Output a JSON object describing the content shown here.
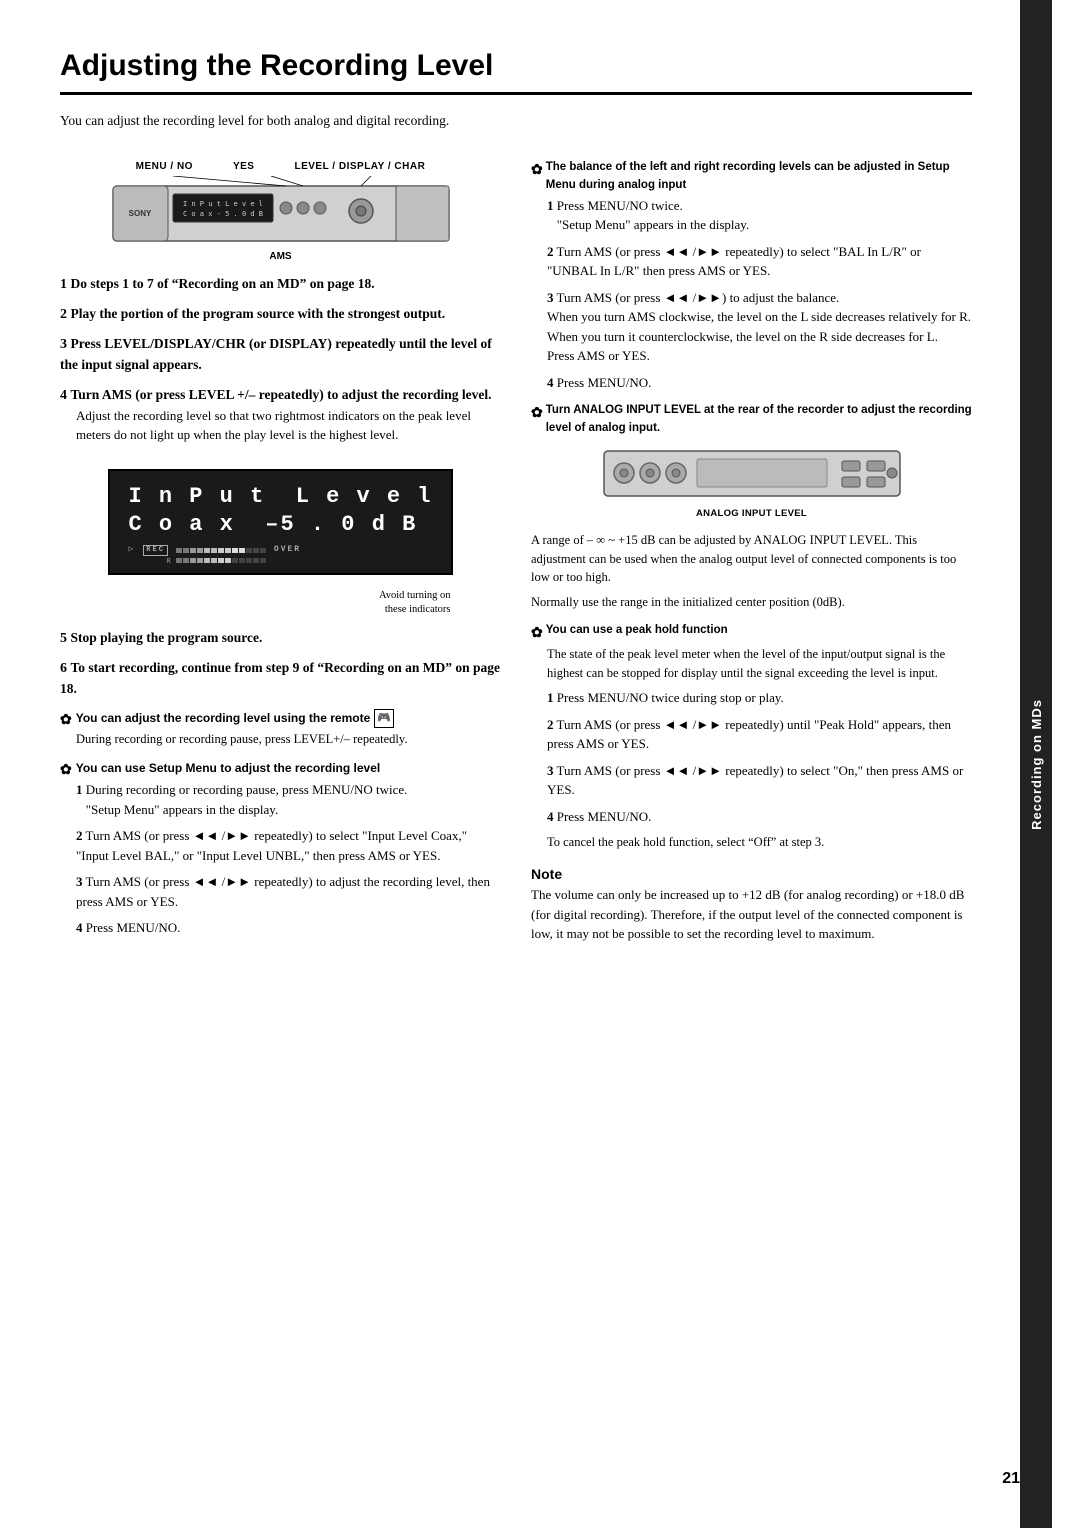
{
  "page": {
    "title": "Adjusting the Recording Level",
    "sidebar_label": "Recording on MDs",
    "page_number": "21",
    "intro": "You can adjust the recording level for both analog and digital recording."
  },
  "diagram_top": {
    "labels": [
      "MENU / NO",
      "YES",
      "LEVEL / DISPLAY / CHAR"
    ],
    "ams_label": "AMS",
    "avoid_text": "Avoid turning on\nthese indicators"
  },
  "analog_diagram": {
    "label": "ANALOG INPUT LEVEL"
  },
  "left_col": {
    "steps": [
      {
        "num": "1",
        "bold": "Do steps 1 to 7 of “Recording on an MD” on page 18."
      },
      {
        "num": "2",
        "bold": "Play the portion of the program source with the strongest output."
      },
      {
        "num": "3",
        "bold": "Press LEVEL/DISPLAY/CHR (or DISPLAY) repeatedly until the level of the input signal appears."
      },
      {
        "num": "4",
        "bold": "Turn AMS (or press LEVEL +/– repeatedly) to adjust the recording level.",
        "body": "Adjust the recording level so that two rightmost indicators on the peak level meters do not light up when the play level is the highest level."
      },
      {
        "num": "5",
        "bold": "Stop playing the program source."
      },
      {
        "num": "6",
        "bold": "To start recording, continue from step 9 of “Recording on an MD” on page 18."
      }
    ],
    "tip1": {
      "header": "You can adjust the recording level using the remote",
      "body": "During recording or recording pause, press LEVEL+/– repeatedly."
    },
    "tip2": {
      "header": "You can use Setup Menu to adjust the recording level",
      "steps": [
        {
          "num": "1",
          "text": "During recording or recording pause, press MENU/NO twice.\n“Setup Menu” appears in the display."
        },
        {
          "num": "2",
          "text": "Turn AMS (or press ◄◄ /►►► repeatedly) to select “Input Level Coax,” “Input Level BAL,” or “Input Level UNBL,” then press AMS or YES."
        },
        {
          "num": "3",
          "text": "Turn AMS (or press ◄◄ /►►► repeatedly) to adjust the recording level, then press AMS or YES."
        },
        {
          "num": "4",
          "text": "Press MENU/NO."
        }
      ]
    }
  },
  "right_col": {
    "tip_balance": {
      "header": "The balance of the left and right recording levels can be adjusted in Setup Menu during analog input",
      "steps": [
        {
          "num": "1",
          "text": "Press MENU/NO twice.\n“Setup Menu” appears in the display."
        },
        {
          "num": "2",
          "text": "Turn AMS (or press ◄◄ /►►► repeatedly) to select “BAL In L/R” or “UNBAL In L/R” then press AMS or YES."
        },
        {
          "num": "3",
          "text": "Turn AMS (or press ◄◄ /►►►) to adjust the balance.\nWhen you turn AMS clockwise, the level on the L side decreases relatively for R. When you turn it counterclockwise, the level on the R side decreases for L.\nPress AMS or YES."
        },
        {
          "num": "4",
          "text": "Press MENU/NO."
        }
      ]
    },
    "tip_analog": {
      "header": "Turn ANALOG INPUT LEVEL at the rear of the recorder to adjust the recording level of analog input."
    },
    "analog_range_text": "A range of – ∞ ~ +15 dB can be adjusted by ANALOG INPUT LEVEL. This adjustment can be used when the analog output level of connected components is too low or too high.",
    "analog_normal_text": "Normally use the range in the initialized center position (0dB).",
    "tip_peak": {
      "header": "You can use a peak hold function",
      "body": "The state of the peak level meter when the level of the input/output signal is the highest can be stopped for display until the signal exceeding the level is input.",
      "steps": [
        {
          "num": "1",
          "text": "Press MENU/NO twice during stop or play."
        },
        {
          "num": "2",
          "text": "Turn AMS (or press ◄◄ /►►► repeatedly) until “Peak Hold” appears, then press AMS or YES."
        },
        {
          "num": "3",
          "text": "Turn AMS (or press ◄◄ /►►► repeatedly) to select “On,” then press AMS or YES."
        },
        {
          "num": "4",
          "text": "Press MENU/NO."
        }
      ],
      "cancel_text": "To cancel the peak hold function, select “Off” at step 3."
    },
    "note": {
      "title": "Note",
      "text": "The volume can only be increased up to +12 dB (for analog recording) or +18.0 dB (for digital recording). Therefore, if the output level of the connected component is low, it may not be possible to set the recording level to maximum."
    }
  },
  "display_text": {
    "line1": "Input Level",
    "line2": "Coax  -5.0dB"
  }
}
